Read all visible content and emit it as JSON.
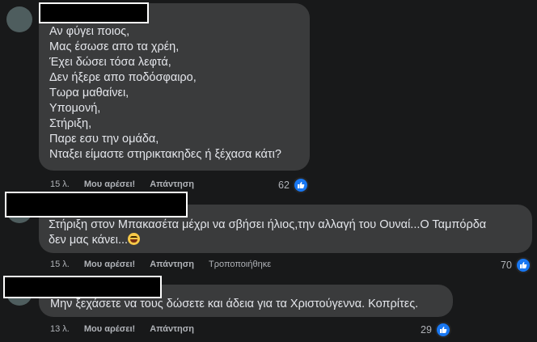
{
  "comments": [
    {
      "lines": [
        "Αν φύγει ποιος,",
        "Μας έσωσε απο τα χρέη,",
        "Έχει δώσει τόσα λεφτά,",
        "Δεν ήξερε απο ποδόσφαιρο,",
        "Τωρα μαθαίνει,",
        "Υπομονή,",
        "Στήριξη,",
        "Παρε εσυ την ομάδα,",
        "Νταξει είμαστε στηρικτακηδες ή ξέχασα κάτι?"
      ],
      "time": "15 λ.",
      "like_label": "Μου αρέσει!",
      "reply_label": "Απάντηση",
      "reaction_count": "62"
    },
    {
      "lines": [
        "Στήριξη στον Μπακασέτα μέχρι να σβήσει ήλιος,την αλλαγή του Ουναί...Ο Ταμπόρδα",
        "δεν μας κάνει..."
      ],
      "time": "15 λ.",
      "like_label": "Μου αρέσει!",
      "reply_label": "Απάντηση",
      "edited_label": "Τροποποιήθηκε",
      "reaction_count": "70"
    },
    {
      "lines": [
        "Μην ξεχάσετε να τους δώσετε και άδεια για τα Χριστούγεννα. Κοπρίτες."
      ],
      "time": "13 λ.",
      "like_label": "Μου αρέσει!",
      "reply_label": "Απάντηση",
      "reaction_count": "29"
    }
  ],
  "colors": {
    "background": "#18191a",
    "bubble": "#3a3b3c",
    "text": "#e4e6eb",
    "secondary_text": "#b0b3b8",
    "like_blue": "#1877f2"
  }
}
